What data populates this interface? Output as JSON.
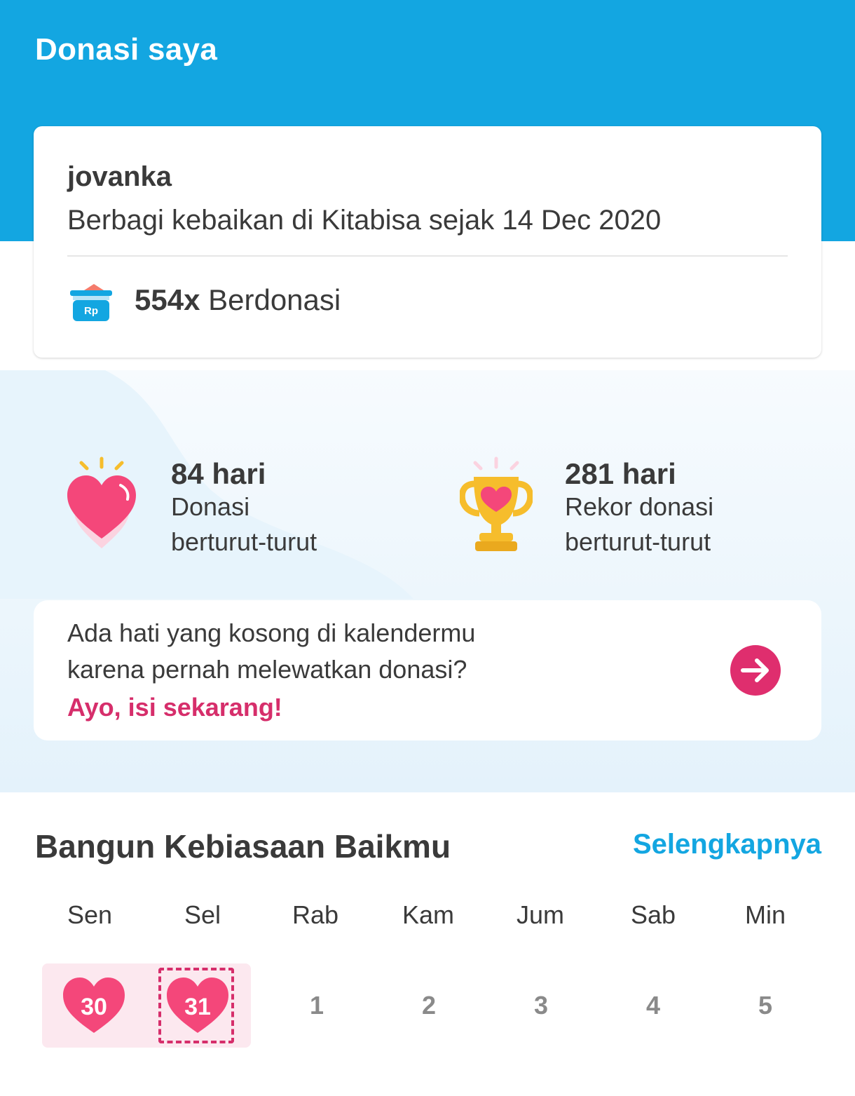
{
  "header": {
    "title": "Donasi saya"
  },
  "profile": {
    "name": "jovanka",
    "since": "Berbagi kebaikan di Kitabisa sejak 14 Dec 2020",
    "donation_count": "554x",
    "donation_label": "Berdonasi",
    "icon_text": "Rp"
  },
  "stats": [
    {
      "value": "84 hari",
      "label_line1": "Donasi",
      "label_line2": "berturut-turut",
      "icon": "heart-icon"
    },
    {
      "value": "281 hari",
      "label_line1": "Rekor donasi",
      "label_line2": "berturut-turut",
      "icon": "trophy-icon"
    }
  ],
  "cta": {
    "line1": "Ada hati yang kosong di kalendermu",
    "line2": "karena pernah melewatkan donasi?",
    "link": "Ayo, isi sekarang!",
    "icon": "arrow-right-icon"
  },
  "habit": {
    "title": "Bangun Kebiasaan Baikmu",
    "see_more": "Selengkapnya",
    "weekdays": [
      "Sen",
      "Sel",
      "Rab",
      "Kam",
      "Jum",
      "Sab",
      "Min"
    ],
    "days": [
      {
        "num": "30",
        "donated": true,
        "today": false
      },
      {
        "num": "31",
        "donated": true,
        "today": true
      },
      {
        "num": "1",
        "donated": false,
        "today": false
      },
      {
        "num": "2",
        "donated": false,
        "today": false
      },
      {
        "num": "3",
        "donated": false,
        "today": false
      },
      {
        "num": "4",
        "donated": false,
        "today": false
      },
      {
        "num": "5",
        "donated": false,
        "today": false
      }
    ]
  },
  "colors": {
    "brand_blue": "#13a6e1",
    "accent_pink": "#df2e6e",
    "streak_bg": "#fce8ef",
    "gold": "#f6bd2c"
  }
}
